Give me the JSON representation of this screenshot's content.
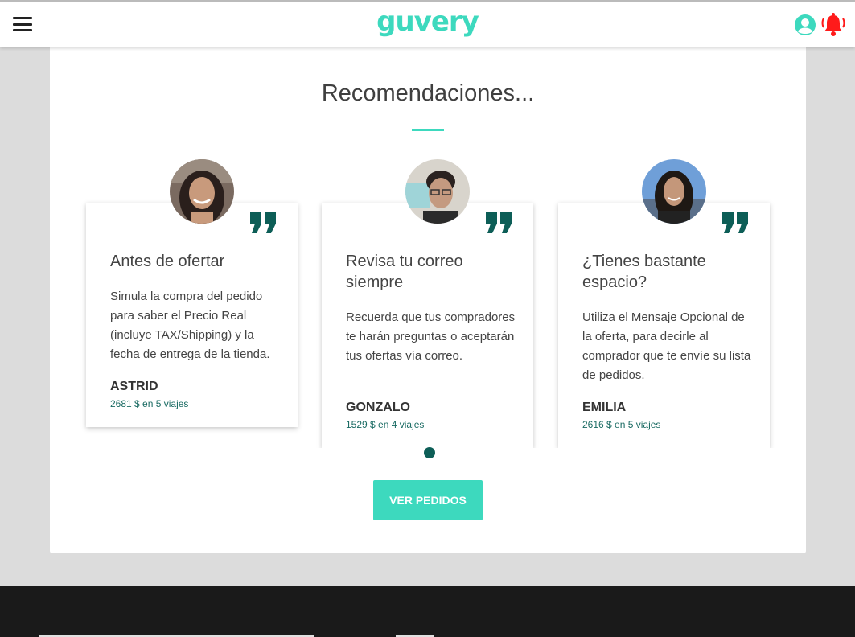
{
  "header": {
    "logo": "guvery",
    "menu_icon": "hamburger-menu-icon",
    "user_icon": "user-circle-icon",
    "bell_icon": "bell-icon",
    "brand_color": "#3dd9be",
    "alert_color": "#ff1a1a"
  },
  "recommendations": {
    "title": "Recomendaciones...",
    "cards": [
      {
        "title": "Antes de ofertar",
        "text": "Simula la compra del pedido para saber el Precio Real (incluye TAX/Shipping) y la fecha de entrega de la tienda.",
        "name": "ASTRID",
        "stats": "2681 $ en 5 viajes"
      },
      {
        "title": "Revisa tu correo siempre",
        "text": "Recuerda que tus compradores te harán preguntas o aceptarán tus ofertas vía correo.",
        "name": "GONZALO",
        "stats": "1529 $ en 4 viajes"
      },
      {
        "title": "¿Tienes bastante espacio?",
        "text": "Utiliza el Mensaje Opcional de la oferta, para decirle al comprador que te envíe su lista de pedidos.",
        "name": "EMILIA",
        "stats": "2616 $ en 5 viajes"
      }
    ],
    "quote_color": "#0d5e57"
  },
  "cta": {
    "label": "VER PEDIDOS"
  }
}
